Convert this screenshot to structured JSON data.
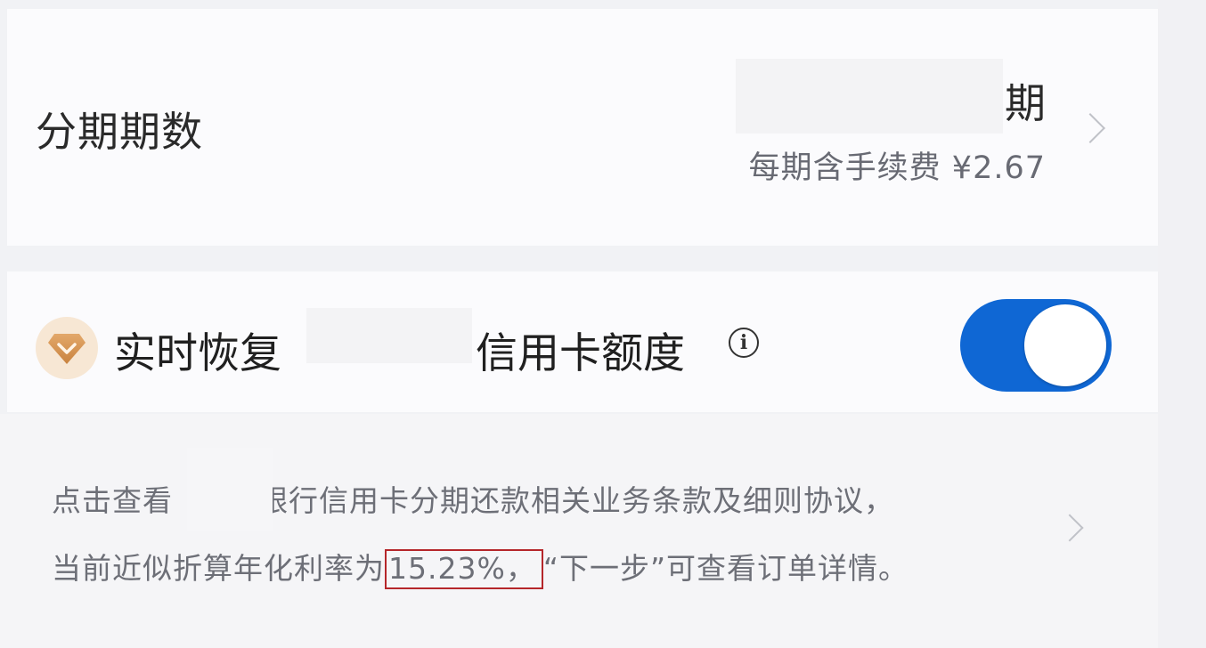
{
  "installment": {
    "label": "分期期数",
    "unit": "期",
    "fee": "每期含手续费 ¥2.67"
  },
  "restore_limit": {
    "prefix": "实时恢复",
    "suffix": "信用卡额度",
    "icon": "diamond-badge-icon",
    "toggle_state": "on",
    "accent_color": "#0f67d4"
  },
  "terms": {
    "line1_prefix": "点击查看",
    "line1_suffix": "银行信用卡分期还款相关业务条款及细则协议，",
    "line2_prefix": "当前近似折算年化利率为",
    "rate": "15.23%，",
    "line2_suffix": "“下一步”可查看订单详情。",
    "highlight_color": "#b5262a"
  }
}
